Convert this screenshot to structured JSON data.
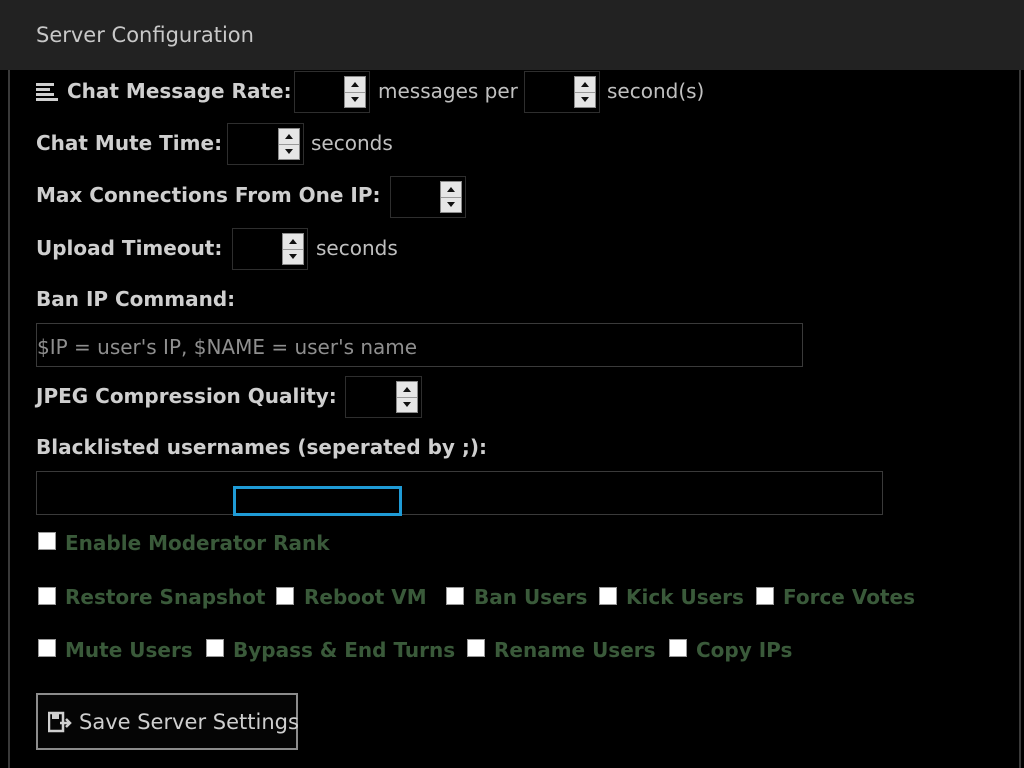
{
  "header": {
    "title": "Server Configuration"
  },
  "chat_rate": {
    "label": "Chat Message Rate:",
    "messages_value": "",
    "middle_text": "messages per",
    "seconds_value": "",
    "suffix": "second(s)"
  },
  "chat_mute": {
    "label": "Chat Mute Time:",
    "value": "",
    "suffix": "seconds"
  },
  "max_conn": {
    "label": "Max Connections From One IP:",
    "value": ""
  },
  "upload_timeout": {
    "label": "Upload Timeout:",
    "value": "",
    "suffix": "seconds"
  },
  "ban_ip": {
    "label": "Ban IP Command:",
    "placeholder": "$IP = user's IP, $NAME = user's name",
    "value": ""
  },
  "jpeg_quality": {
    "label": "JPEG Compression Quality:",
    "value": ""
  },
  "blacklist": {
    "label": "Blacklisted usernames (seperated by ;):",
    "value": ""
  },
  "moderator": {
    "enable_label": "Enable Moderator Rank",
    "permissions_row1": [
      {
        "label": "Restore Snapshot",
        "checked": false
      },
      {
        "label": "Reboot VM",
        "checked": false
      },
      {
        "label": "Ban Users",
        "checked": false
      },
      {
        "label": "Kick Users",
        "checked": false
      },
      {
        "label": "Force Votes",
        "checked": false
      }
    ],
    "permissions_row2": [
      {
        "label": "Mute Users",
        "checked": false
      },
      {
        "label": "Bypass & End Turns",
        "checked": false
      },
      {
        "label": "Rename Users",
        "checked": false
      },
      {
        "label": "Copy IPs",
        "checked": false
      }
    ]
  },
  "save_button": {
    "label": "Save Server Settings"
  },
  "icons": {
    "list": "list-lines-icon",
    "save": "save-file-icon",
    "spin_up": "chevron-up-icon",
    "spin_down": "chevron-down-icon"
  },
  "colors": {
    "accent_focus": "#1f9bd6",
    "checkbox_label": "#3a5a3a",
    "header_bg": "#222222"
  }
}
